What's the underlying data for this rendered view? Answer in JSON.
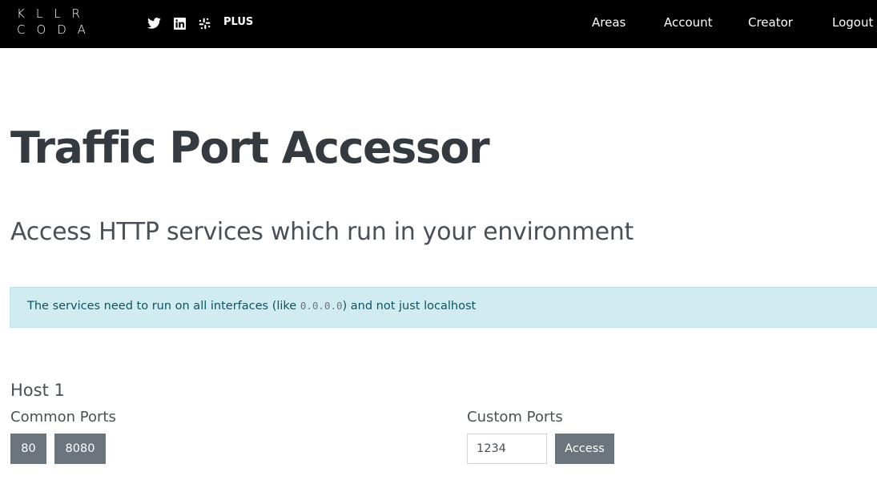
{
  "navbar": {
    "logo_line1": "KLLR",
    "logo_line2": "CODA",
    "social": [
      "twitter-icon",
      "linkedin-icon",
      "slack-icon"
    ],
    "plus_label": "PLUS",
    "links": [
      "Areas",
      "Account",
      "Creator",
      "Logout"
    ]
  },
  "main": {
    "title": "Traffic Port Accessor",
    "subtitle": "Access HTTP services which run in your environment",
    "alert": {
      "text_before": "The services need to run on all interfaces (like ",
      "code": "0.0.0.0",
      "text_after": ") and not just localhost"
    },
    "host": {
      "title": "Host 1",
      "common_label": "Common Ports",
      "common_ports": [
        "80",
        "8080"
      ],
      "custom_label": "Custom Ports",
      "custom_value": "1234",
      "access_label": "Access"
    }
  },
  "colors": {
    "navbar_bg": "#000000",
    "alert_bg": "#d1ecf1",
    "alert_text": "#0c5460",
    "button_bg": "#6c757d"
  }
}
